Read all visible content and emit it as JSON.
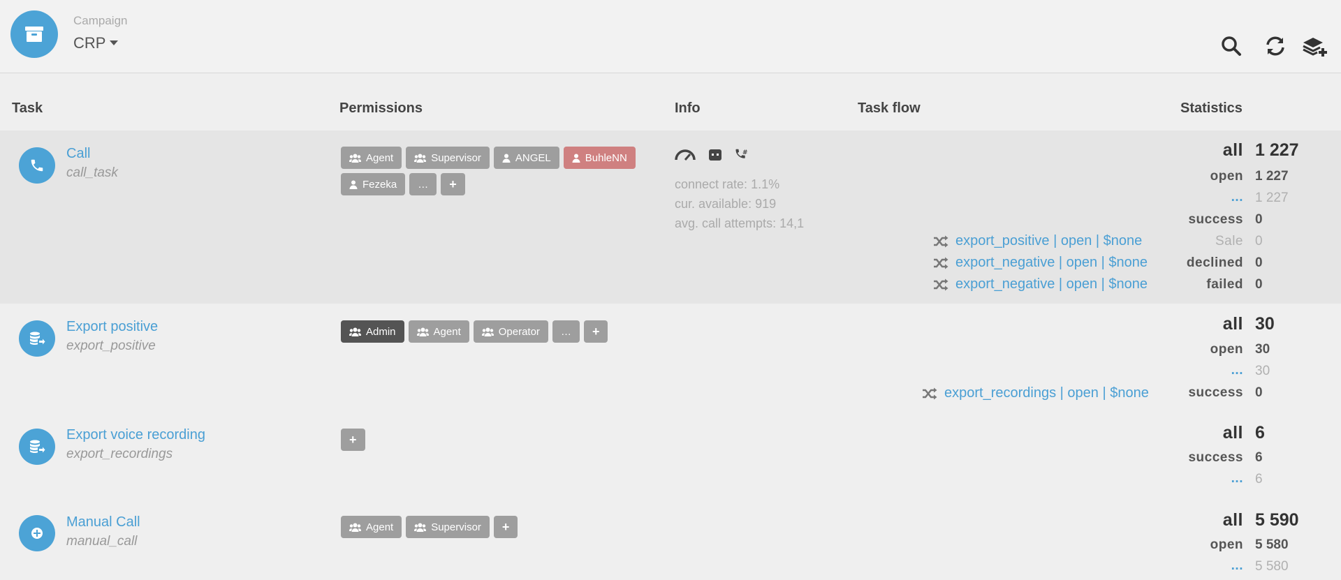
{
  "header": {
    "campaign_label": "Campaign",
    "campaign_value": "CRP",
    "icons": [
      "archive-icon",
      "search-icon",
      "refresh-icon",
      "add-layer-icon"
    ]
  },
  "columns": {
    "task": "Task",
    "permissions": "Permissions",
    "info": "Info",
    "task_flow": "Task flow",
    "statistics": "Statistics"
  },
  "tasks": [
    {
      "name": "Call",
      "id": "call_task",
      "icon": "phone-icon",
      "permissions": [
        {
          "label": "Agent",
          "type": "group"
        },
        {
          "label": "Supervisor",
          "type": "group"
        },
        {
          "label": "ANGEL",
          "type": "user"
        },
        {
          "label": "BuhleNN",
          "type": "user"
        },
        {
          "label": "Fezeka",
          "type": "user"
        },
        {
          "label": "…",
          "type": "more"
        },
        {
          "label": "+",
          "type": "add"
        }
      ],
      "info": {
        "icons": [
          "gauge-icon",
          "robot-icon",
          "phone-hash-icon"
        ],
        "connect_rate": "connect rate: 1.1%",
        "available": "cur. available: 919",
        "attempts": "avg. call attempts: 14,1"
      },
      "flows": [
        "export_positive | open | $none",
        "export_negative | open | $none",
        "export_negative | open | $none"
      ],
      "stats": [
        {
          "label": "all",
          "value": "1 227"
        },
        {
          "label": "open",
          "value": "1 227"
        },
        {
          "label": "...",
          "value": "1 227"
        },
        {
          "label": "success",
          "value": "0"
        },
        {
          "label": "Sale",
          "value": "0"
        },
        {
          "label": "declined",
          "value": "0"
        },
        {
          "label": "failed",
          "value": "0"
        }
      ]
    },
    {
      "name": "Export positive",
      "id": "export_positive",
      "icon": "database-export-icon",
      "permissions": [
        {
          "label": "Admin",
          "type": "group"
        },
        {
          "label": "Agent",
          "type": "group"
        },
        {
          "label": "Operator",
          "type": "group"
        },
        {
          "label": "…",
          "type": "more"
        },
        {
          "label": "+",
          "type": "add"
        }
      ],
      "flows": [
        "export_recordings | open | $none"
      ],
      "stats": [
        {
          "label": "all",
          "value": "30"
        },
        {
          "label": "open",
          "value": "30"
        },
        {
          "label": "...",
          "value": "30"
        },
        {
          "label": "success",
          "value": "0"
        }
      ]
    },
    {
      "name": "Export voice recording",
      "id": "export_recordings",
      "icon": "database-export-icon",
      "permissions": [
        {
          "label": "+",
          "type": "add"
        }
      ],
      "stats": [
        {
          "label": "all",
          "value": "6"
        },
        {
          "label": "success",
          "value": "6"
        },
        {
          "label": "...",
          "value": "6"
        }
      ]
    },
    {
      "name": "Manual Call",
      "id": "manual_call",
      "icon": "plus-circle-icon",
      "permissions": [
        {
          "label": "Agent",
          "type": "group"
        },
        {
          "label": "Supervisor",
          "type": "group"
        },
        {
          "label": "+",
          "type": "add"
        }
      ],
      "stats": [
        {
          "label": "all",
          "value": "5 590"
        },
        {
          "label": "open",
          "value": "5 580"
        },
        {
          "label": "...",
          "value": "5 580"
        }
      ]
    }
  ]
}
